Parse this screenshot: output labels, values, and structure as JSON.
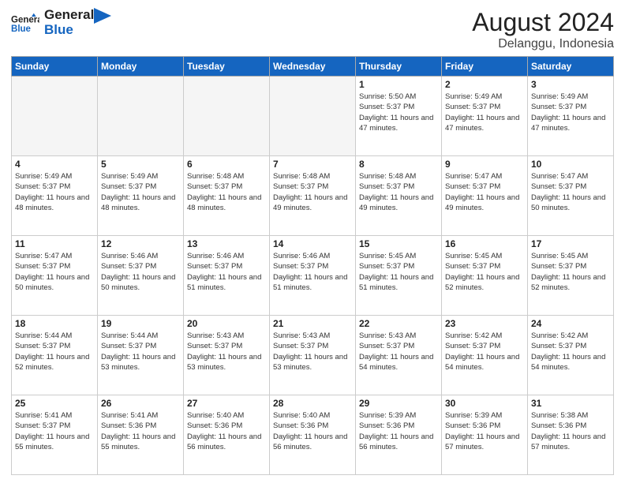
{
  "header": {
    "logo_general": "General",
    "logo_blue": "Blue",
    "month_year": "August 2024",
    "location": "Delanggu, Indonesia"
  },
  "weekdays": [
    "Sunday",
    "Monday",
    "Tuesday",
    "Wednesday",
    "Thursday",
    "Friday",
    "Saturday"
  ],
  "weeks": [
    [
      {
        "day": "",
        "sunrise": "",
        "sunset": "",
        "daylight": ""
      },
      {
        "day": "",
        "sunrise": "",
        "sunset": "",
        "daylight": ""
      },
      {
        "day": "",
        "sunrise": "",
        "sunset": "",
        "daylight": ""
      },
      {
        "day": "",
        "sunrise": "",
        "sunset": "",
        "daylight": ""
      },
      {
        "day": "1",
        "sunrise": "Sunrise: 5:50 AM",
        "sunset": "Sunset: 5:37 PM",
        "daylight": "Daylight: 11 hours and 47 minutes."
      },
      {
        "day": "2",
        "sunrise": "Sunrise: 5:49 AM",
        "sunset": "Sunset: 5:37 PM",
        "daylight": "Daylight: 11 hours and 47 minutes."
      },
      {
        "day": "3",
        "sunrise": "Sunrise: 5:49 AM",
        "sunset": "Sunset: 5:37 PM",
        "daylight": "Daylight: 11 hours and 47 minutes."
      }
    ],
    [
      {
        "day": "4",
        "sunrise": "Sunrise: 5:49 AM",
        "sunset": "Sunset: 5:37 PM",
        "daylight": "Daylight: 11 hours and 48 minutes."
      },
      {
        "day": "5",
        "sunrise": "Sunrise: 5:49 AM",
        "sunset": "Sunset: 5:37 PM",
        "daylight": "Daylight: 11 hours and 48 minutes."
      },
      {
        "day": "6",
        "sunrise": "Sunrise: 5:48 AM",
        "sunset": "Sunset: 5:37 PM",
        "daylight": "Daylight: 11 hours and 48 minutes."
      },
      {
        "day": "7",
        "sunrise": "Sunrise: 5:48 AM",
        "sunset": "Sunset: 5:37 PM",
        "daylight": "Daylight: 11 hours and 49 minutes."
      },
      {
        "day": "8",
        "sunrise": "Sunrise: 5:48 AM",
        "sunset": "Sunset: 5:37 PM",
        "daylight": "Daylight: 11 hours and 49 minutes."
      },
      {
        "day": "9",
        "sunrise": "Sunrise: 5:47 AM",
        "sunset": "Sunset: 5:37 PM",
        "daylight": "Daylight: 11 hours and 49 minutes."
      },
      {
        "day": "10",
        "sunrise": "Sunrise: 5:47 AM",
        "sunset": "Sunset: 5:37 PM",
        "daylight": "Daylight: 11 hours and 50 minutes."
      }
    ],
    [
      {
        "day": "11",
        "sunrise": "Sunrise: 5:47 AM",
        "sunset": "Sunset: 5:37 PM",
        "daylight": "Daylight: 11 hours and 50 minutes."
      },
      {
        "day": "12",
        "sunrise": "Sunrise: 5:46 AM",
        "sunset": "Sunset: 5:37 PM",
        "daylight": "Daylight: 11 hours and 50 minutes."
      },
      {
        "day": "13",
        "sunrise": "Sunrise: 5:46 AM",
        "sunset": "Sunset: 5:37 PM",
        "daylight": "Daylight: 11 hours and 51 minutes."
      },
      {
        "day": "14",
        "sunrise": "Sunrise: 5:46 AM",
        "sunset": "Sunset: 5:37 PM",
        "daylight": "Daylight: 11 hours and 51 minutes."
      },
      {
        "day": "15",
        "sunrise": "Sunrise: 5:45 AM",
        "sunset": "Sunset: 5:37 PM",
        "daylight": "Daylight: 11 hours and 51 minutes."
      },
      {
        "day": "16",
        "sunrise": "Sunrise: 5:45 AM",
        "sunset": "Sunset: 5:37 PM",
        "daylight": "Daylight: 11 hours and 52 minutes."
      },
      {
        "day": "17",
        "sunrise": "Sunrise: 5:45 AM",
        "sunset": "Sunset: 5:37 PM",
        "daylight": "Daylight: 11 hours and 52 minutes."
      }
    ],
    [
      {
        "day": "18",
        "sunrise": "Sunrise: 5:44 AM",
        "sunset": "Sunset: 5:37 PM",
        "daylight": "Daylight: 11 hours and 52 minutes."
      },
      {
        "day": "19",
        "sunrise": "Sunrise: 5:44 AM",
        "sunset": "Sunset: 5:37 PM",
        "daylight": "Daylight: 11 hours and 53 minutes."
      },
      {
        "day": "20",
        "sunrise": "Sunrise: 5:43 AM",
        "sunset": "Sunset: 5:37 PM",
        "daylight": "Daylight: 11 hours and 53 minutes."
      },
      {
        "day": "21",
        "sunrise": "Sunrise: 5:43 AM",
        "sunset": "Sunset: 5:37 PM",
        "daylight": "Daylight: 11 hours and 53 minutes."
      },
      {
        "day": "22",
        "sunrise": "Sunrise: 5:43 AM",
        "sunset": "Sunset: 5:37 PM",
        "daylight": "Daylight: 11 hours and 54 minutes."
      },
      {
        "day": "23",
        "sunrise": "Sunrise: 5:42 AM",
        "sunset": "Sunset: 5:37 PM",
        "daylight": "Daylight: 11 hours and 54 minutes."
      },
      {
        "day": "24",
        "sunrise": "Sunrise: 5:42 AM",
        "sunset": "Sunset: 5:37 PM",
        "daylight": "Daylight: 11 hours and 54 minutes."
      }
    ],
    [
      {
        "day": "25",
        "sunrise": "Sunrise: 5:41 AM",
        "sunset": "Sunset: 5:37 PM",
        "daylight": "Daylight: 11 hours and 55 minutes."
      },
      {
        "day": "26",
        "sunrise": "Sunrise: 5:41 AM",
        "sunset": "Sunset: 5:36 PM",
        "daylight": "Daylight: 11 hours and 55 minutes."
      },
      {
        "day": "27",
        "sunrise": "Sunrise: 5:40 AM",
        "sunset": "Sunset: 5:36 PM",
        "daylight": "Daylight: 11 hours and 56 minutes."
      },
      {
        "day": "28",
        "sunrise": "Sunrise: 5:40 AM",
        "sunset": "Sunset: 5:36 PM",
        "daylight": "Daylight: 11 hours and 56 minutes."
      },
      {
        "day": "29",
        "sunrise": "Sunrise: 5:39 AM",
        "sunset": "Sunset: 5:36 PM",
        "daylight": "Daylight: 11 hours and 56 minutes."
      },
      {
        "day": "30",
        "sunrise": "Sunrise: 5:39 AM",
        "sunset": "Sunset: 5:36 PM",
        "daylight": "Daylight: 11 hours and 57 minutes."
      },
      {
        "day": "31",
        "sunrise": "Sunrise: 5:38 AM",
        "sunset": "Sunset: 5:36 PM",
        "daylight": "Daylight: 11 hours and 57 minutes."
      }
    ]
  ]
}
